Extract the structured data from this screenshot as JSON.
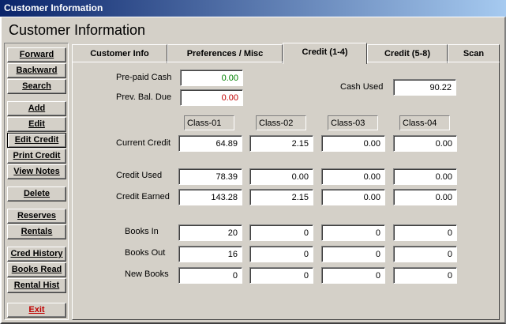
{
  "window": {
    "title": "Customer Information"
  },
  "heading": "Customer Information",
  "sidebar": {
    "forward": "Forward",
    "backward": "Backward",
    "search": "Search",
    "add": "Add",
    "edit": "Edit",
    "edit_credit": "Edit Credit",
    "print_credit": "Print Credit",
    "view_notes": "View Notes",
    "delete": "Delete",
    "reserves": "Reserves",
    "rentals": "Rentals",
    "cred_history": "Cred History",
    "books_read": "Books Read",
    "rental_hist": "Rental Hist",
    "exit": "Exit"
  },
  "tabs": {
    "customer_info": "Customer Info",
    "preferences": "Preferences / Misc",
    "credit_1_4": "Credit (1-4)",
    "credit_5_8": "Credit (5-8)",
    "scan": "Scan",
    "active": "Credit (1-4)"
  },
  "credit": {
    "prepaid_cash_label": "Pre-paid Cash",
    "prepaid_cash": "0.00",
    "prev_bal_due_label": "Prev. Bal. Due",
    "prev_bal_due": "0.00",
    "cash_used_label": "Cash Used",
    "cash_used": "90.22",
    "classes": [
      "Class-01",
      "Class-02",
      "Class-03",
      "Class-04"
    ],
    "rows": [
      {
        "label": "Current Credit",
        "values": [
          "64.89",
          "2.15",
          "0.00",
          "0.00"
        ]
      },
      {
        "label": "Credit Used",
        "values": [
          "78.39",
          "0.00",
          "0.00",
          "0.00"
        ]
      },
      {
        "label": "Credit Earned",
        "values": [
          "143.28",
          "2.15",
          "0.00",
          "0.00"
        ]
      },
      {
        "label": "Books In",
        "values": [
          "20",
          "0",
          "0",
          "0"
        ]
      },
      {
        "label": "Books Out",
        "values": [
          "16",
          "0",
          "0",
          "0"
        ]
      },
      {
        "label": "New Books",
        "values": [
          "0",
          "0",
          "0",
          "0"
        ]
      }
    ]
  },
  "colors": {
    "titlebar_start": "#0a246a",
    "titlebar_end": "#a6caf0",
    "prepaid_text": "#008000",
    "balance_text": "#c00000",
    "exit_text": "#c00000",
    "face": "#d4d0c8"
  }
}
